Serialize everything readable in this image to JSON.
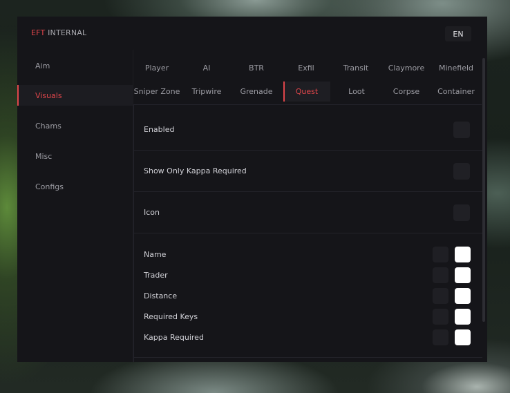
{
  "app": {
    "title_accent": "EFT",
    "title_rest": "INTERNAL",
    "language": "EN"
  },
  "sidebar": {
    "items": [
      {
        "label": "Aim"
      },
      {
        "label": "Visuals",
        "active": true
      },
      {
        "label": "Chams"
      },
      {
        "label": "Misc"
      },
      {
        "label": "Configs"
      }
    ]
  },
  "tabs": {
    "row1": [
      "Player",
      "AI",
      "BTR",
      "Exfil",
      "Transit",
      "Claymore",
      "Minefield"
    ],
    "row2": [
      "Sniper Zone",
      "Tripwire",
      "Grenade",
      "Quest",
      "Loot",
      "Corpse",
      "Container"
    ],
    "active": "Quest"
  },
  "settings": {
    "enabled": {
      "label": "Enabled",
      "checked": false
    },
    "show_only_kappa": {
      "label": "Show Only Kappa Required",
      "checked": false
    },
    "icon": {
      "label": "Icon",
      "checked": false
    },
    "display": [
      {
        "label": "Name",
        "color": "#ffffff"
      },
      {
        "label": "Trader",
        "color": "#ffffff"
      },
      {
        "label": "Distance",
        "color": "#ffffff"
      },
      {
        "label": "Required Keys",
        "color": "#ffffff"
      },
      {
        "label": "Kappa Required",
        "color": "#ffffff"
      }
    ]
  },
  "colors": {
    "accent": "#e0464b",
    "panel": "#151519"
  }
}
